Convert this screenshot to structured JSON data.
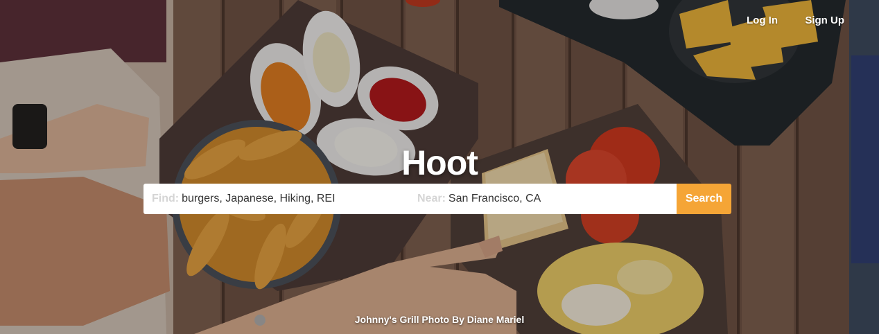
{
  "nav": {
    "login": "Log In",
    "signup": "Sign Up"
  },
  "hero": {
    "title": "Hoot",
    "photo_credit": "Johnny's Grill Photo By Diane Mariel"
  },
  "search": {
    "find_label": "Find:",
    "find_value": "burgers, Japanese, Hiking, REI",
    "near_label": "Near:",
    "near_value": "San Francisco, CA",
    "button_label": "Search"
  },
  "colors": {
    "accent": "#f5a536",
    "wood": "#7a5a48"
  }
}
